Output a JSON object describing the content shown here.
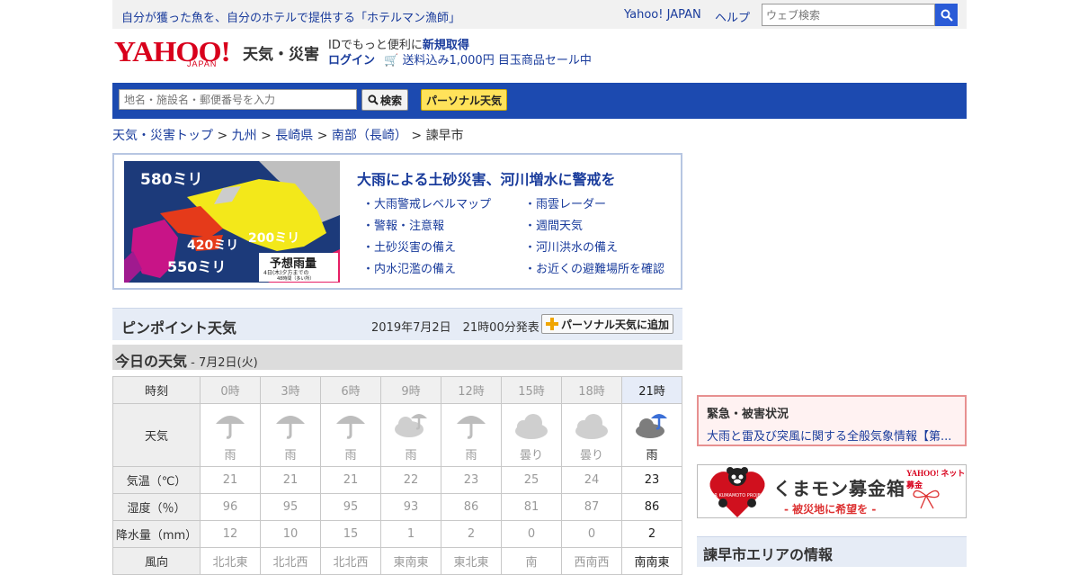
{
  "topbar": {
    "promo": "自分が獲った魚を、自分のホテルで提供する「ホテルマン漁師」",
    "yahoo_japan": "Yahoo! JAPAN",
    "help": "ヘルプ",
    "web_search_placeholder": "ウェブ検索"
  },
  "logo": {
    "brand": "YAHOO!",
    "sub": "JAPAN",
    "service": "天気・災害"
  },
  "id_area": {
    "line1_prefix": "IDでもっと便利に",
    "register": "新規取得",
    "login": "ログイン",
    "sale": "送料込み1,000円 目玉商品セール中"
  },
  "search": {
    "placeholder": "地名・施設名・郵便番号を入力",
    "button": "検索",
    "personal": "パーソナル天気"
  },
  "breadcrumb": [
    "天気・災害トップ",
    "九州",
    "長崎県",
    "南部（長崎）",
    "諫早市"
  ],
  "banner": {
    "title": "大雨による土砂災害、河川増水に警戒を",
    "map_labels": [
      "580ミリ",
      "420ミリ",
      "550ミリ",
      "200ミリ",
      "予想雨量",
      "4日(木)夕方までの",
      "48時間（多い所）"
    ],
    "links_left": [
      "大雨警戒レベルマップ",
      "警報・注意報",
      "土砂災害の備え",
      "内水氾濫の備え"
    ],
    "links_right": [
      "雨雲レーダー",
      "週間天気",
      "河川洪水の備え",
      "お近くの避難場所を確認"
    ]
  },
  "pinpoint": {
    "title": "ピンポイント天気",
    "date": "2019年7月2日　21時00分発表",
    "add_button": "パーソナル天気に追加"
  },
  "today": {
    "title": "今日の天気",
    "date": " - 7月2日(火)"
  },
  "table": {
    "row_labels": [
      "時刻",
      "天気",
      "気温（℃）",
      "湿度（％）",
      "降水量（mm）",
      "風向"
    ],
    "hours": [
      "0時",
      "3時",
      "6時",
      "9時",
      "12時",
      "15時",
      "18時",
      "21時"
    ],
    "weather": [
      "雨",
      "雨",
      "雨",
      "雨",
      "雨",
      "曇り",
      "曇り",
      "雨"
    ],
    "weather_icons": [
      "umbrella-icon",
      "umbrella-icon",
      "umbrella-icon",
      "cloud-umbrella-icon",
      "umbrella-icon",
      "cloud-icon",
      "cloud-icon",
      "cloud-umbrella-icon"
    ],
    "temperature": [
      "21",
      "21",
      "21",
      "22",
      "23",
      "25",
      "24",
      "23"
    ],
    "humidity": [
      "96",
      "95",
      "95",
      "93",
      "86",
      "81",
      "87",
      "86"
    ],
    "precipitation": [
      "12",
      "10",
      "15",
      "1",
      "2",
      "0",
      "0",
      "2"
    ],
    "wind_dir": [
      "北北東",
      "北北西",
      "北北西",
      "東南東",
      "東北東",
      "南",
      "西南西",
      "南南東"
    ]
  },
  "emergency": {
    "title": "緊急・被害状況",
    "link": "大雨と雷及び突風に関する全般気象情報【第..."
  },
  "kumamon": {
    "title": "くまモン募金箱",
    "sub": "- 被災地に希望を -",
    "brand": "YAHOO! ネット募金",
    "badge": "FOR KUMAMOTO PROJECT"
  },
  "area_info": {
    "title": "諫早市エリアの情報"
  },
  "colors": {
    "link": "#1a3c9c",
    "bar": "#1c4ab0",
    "accent_red": "#d8001c",
    "rain_blue": "#3b6fd6"
  }
}
